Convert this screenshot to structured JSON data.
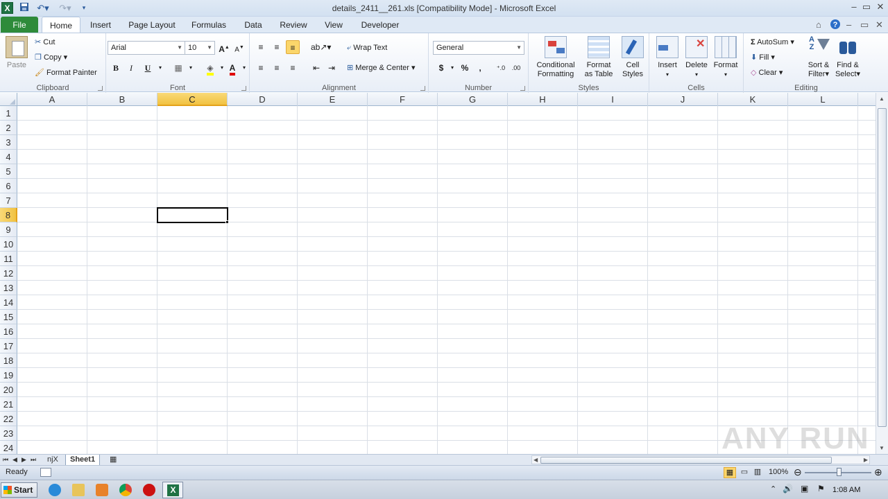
{
  "window": {
    "title": "details_2411__261.xls  [Compatibility Mode]  -  Microsoft Excel"
  },
  "tabs": [
    "File",
    "Home",
    "Insert",
    "Page Layout",
    "Formulas",
    "Data",
    "Review",
    "View",
    "Developer"
  ],
  "clipboard": {
    "paste": "Paste",
    "cut": "Cut",
    "copy": "Copy",
    "format_painter": "Format Painter",
    "label": "Clipboard"
  },
  "font": {
    "name": "Arial",
    "size": "10",
    "label": "Font",
    "bold": "B",
    "italic": "I",
    "underline": "U",
    "font_color_letter": "A"
  },
  "alignment": {
    "wrap": "Wrap Text",
    "merge": "Merge & Center",
    "label": "Alignment"
  },
  "number": {
    "format": "General",
    "currency": "$",
    "percent": "%",
    "comma": ",",
    "label": "Number"
  },
  "styles": {
    "conditional_1": "Conditional",
    "conditional_2": "Formatting",
    "format_table_1": "Format",
    "format_table_2": "as Table",
    "cell_styles_1": "Cell",
    "cell_styles_2": "Styles",
    "label": "Styles"
  },
  "cells": {
    "insert": "Insert",
    "delete": "Delete",
    "format": "Format",
    "label": "Cells"
  },
  "editing": {
    "autosum": "AutoSum",
    "fill": "Fill",
    "clear": "Clear",
    "sort_1": "Sort &",
    "sort_2": "Filter",
    "find_1": "Find &",
    "find_2": "Select",
    "label": "Editing"
  },
  "grid": {
    "columns": [
      "A",
      "B",
      "C",
      "D",
      "E",
      "F",
      "G",
      "H",
      "I",
      "J",
      "K",
      "L"
    ],
    "rows": [
      "1",
      "2",
      "3",
      "4",
      "5",
      "6",
      "7",
      "8",
      "9",
      "10",
      "11",
      "12",
      "13",
      "14",
      "15",
      "16",
      "17",
      "18",
      "19",
      "20",
      "21",
      "22",
      "23",
      "24"
    ],
    "selected_column": "C",
    "selected_row": "8"
  },
  "sheets": [
    "njX",
    "Sheet1"
  ],
  "active_sheet": "Sheet1",
  "status": {
    "text": "Ready",
    "zoom": "100%"
  },
  "taskbar": {
    "start": "Start",
    "clock": "1:08 AM"
  },
  "watermark": "ANY RUN",
  "colors": {
    "file_tab": "#2e8b3a",
    "selection_header": "#f1c241",
    "excel_green": "#1f7244"
  }
}
